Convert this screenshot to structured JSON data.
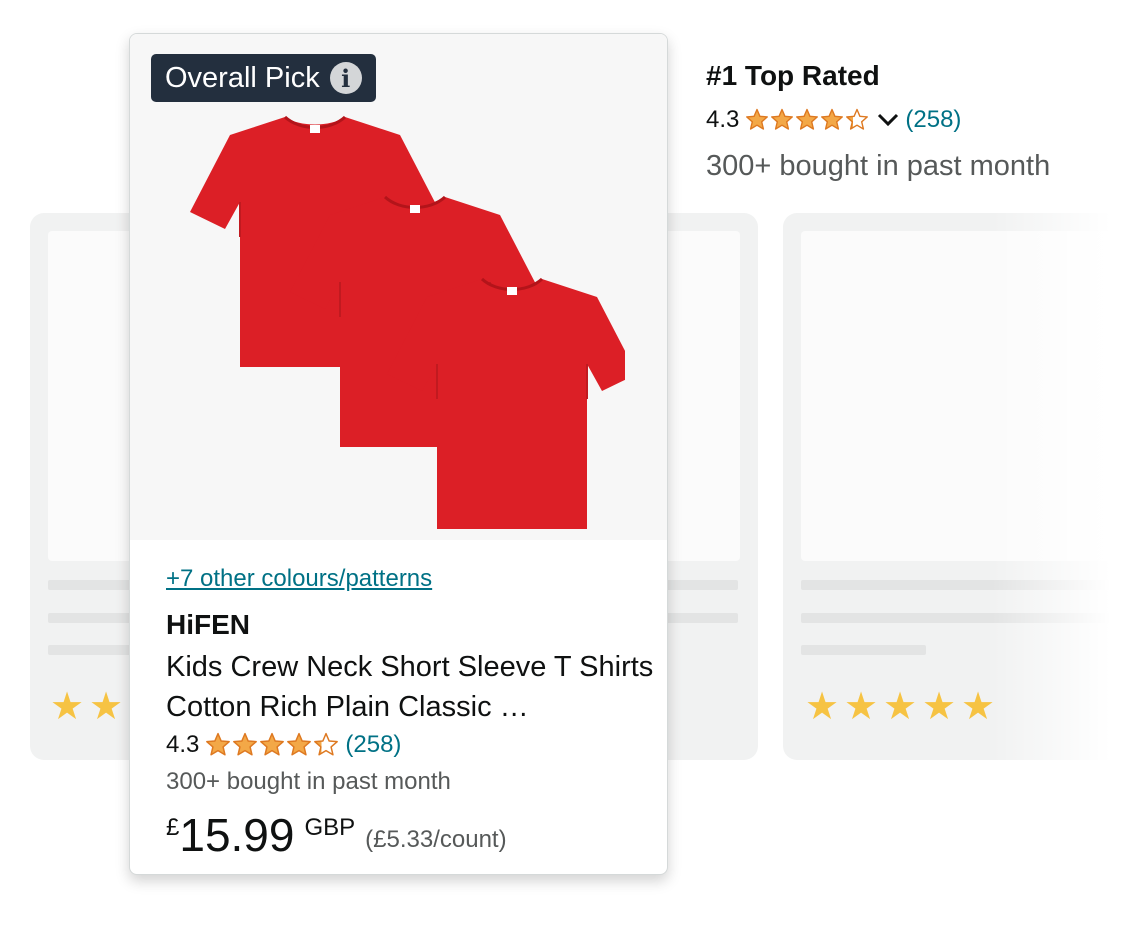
{
  "badge": {
    "label": "Overall Pick",
    "info_icon": "info-icon"
  },
  "product": {
    "colours_link": "+7 other colours/patterns",
    "brand": "HiFEN",
    "title": "Kids Crew Neck Short Sleeve T Shirts Cotton Rich Plain Classic …",
    "rating": "4.3",
    "stars_value": 4.3,
    "reviews": "(258)",
    "bought": "300+ bought in past month",
    "price_symbol": "£",
    "price_whole": "15.99",
    "price_currency": "GBP",
    "price_per_unit": "(£5.33/count)",
    "image": "three-red-tshirts"
  },
  "summary": {
    "heading": "#1 Top Rated",
    "rating": "4.3",
    "stars_value": 4.3,
    "reviews": "(258)",
    "bought": "300+ bought in past month",
    "dropdown_icon": "chevron-down-icon"
  },
  "placeholders": {
    "left_stars_visible": 2,
    "right_stars": 5
  },
  "colors": {
    "star": "#f3a847",
    "link": "#007185",
    "badge_bg": "#232f3e",
    "shirt": "#dc1f26"
  }
}
